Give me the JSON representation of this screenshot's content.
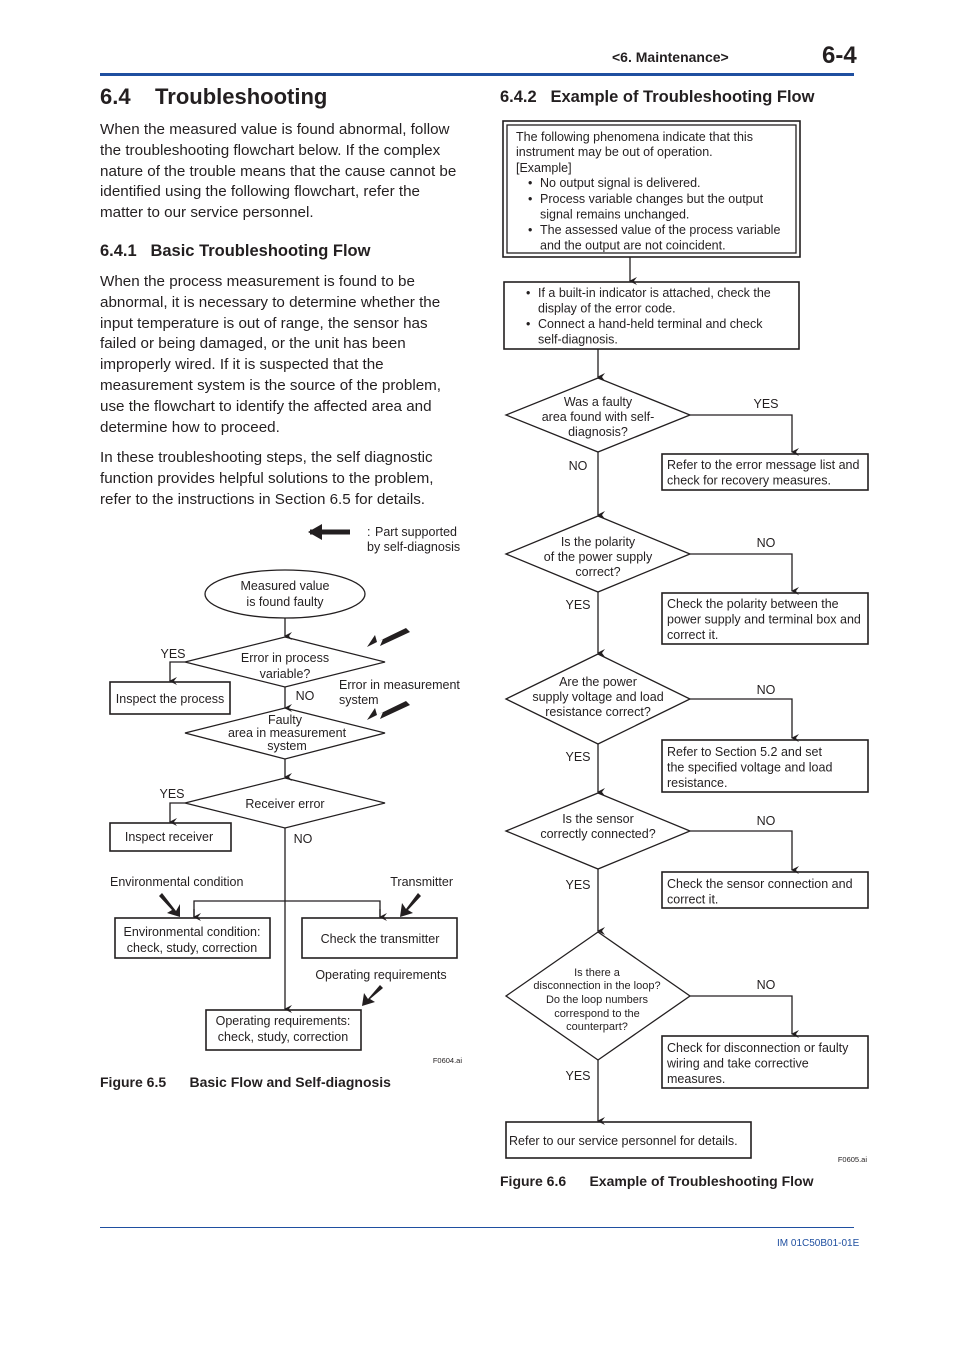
{
  "header": {
    "section": "<6.  Maintenance>",
    "page_number": "6-4"
  },
  "footer": {
    "doc_id": "IM 01C50B01-01E"
  },
  "left": {
    "section_title": "6.4    Troubleshooting",
    "intro": "When the measured value is found abnormal, follow the troubleshooting flowchart below. If the complex nature of the trouble means that the cause cannot be identified using the following flowchart, refer the matter to our service personnel.",
    "subsection_title": "6.4.1   Basic Troubleshooting Flow",
    "para1": "When the process measurement is found to be abnormal, it is necessary to determine whether the input temperature is out of range, the sensor has failed or being damaged, or the unit has been improperly wired. If it is suspected that the measurement system is the source of the problem, use the flowchart to identify the affected area and determine how to proceed.",
    "para2": "In these troubleshooting steps, the self diagnostic function provides helpful solutions to the problem, refer to the instructions in Section 6.5 for details.",
    "figure": {
      "legend_colon": ":",
      "legend_line1": "Part supported",
      "legend_line2": "by self-diagnosis",
      "start_line1": "Measured value",
      "start_line2": "is found faulty",
      "d1_line1": "Error in process",
      "d1_line2": "variable?",
      "yes1": "YES",
      "no1": "NO",
      "inspect_process": "Inspect the process",
      "err_meas_line1": "Error in measurement",
      "err_meas_line2": "system",
      "d2_line1": "Faulty",
      "d2_line2": "area in measurement",
      "d2_line3": "system",
      "d3": "Receiver error",
      "yes3": "YES",
      "no3": "NO",
      "inspect_receiver": "Inspect receiver",
      "env_label": "Environmental condition",
      "transmitter_label": "Transmitter",
      "env_box_line1": "Environmental condition:",
      "env_box_line2": "check, study, correction",
      "check_transmitter": "Check the transmitter",
      "op_label": "Operating requirements",
      "op_box_line1": "Operating requirements:",
      "op_box_line2": "check, study, correction",
      "file_id": "F0604.ai",
      "caption": "Figure 6.5      Basic Flow and Self-diagnosis"
    }
  },
  "right": {
    "subsection_title": "6.4.2   Example of Troubleshooting Flow",
    "figure": {
      "intro_line1": "The following phenomena indicate that this",
      "intro_line2": "instrument may be out of operation.",
      "intro_line3": "[Example]",
      "examples": [
        "No output signal is delivered.",
        "Process variable changes but the output signal remains unchanged.",
        "The assessed value of the process variable and the output are not coincident."
      ],
      "checks": [
        "If a built-in indicator is attached, check the display of the error code.",
        "Connect a hand-held terminal and check self-diagnosis."
      ],
      "q1": [
        "Was a faulty",
        "area found with self-",
        "diagnosis?"
      ],
      "q1_yes": "YES",
      "q1_no": "NO",
      "a1": "Refer to the error message list and check for recovery measures.",
      "q2": [
        "Is the polarity",
        "of the power supply",
        "correct?"
      ],
      "q2_no": "NO",
      "q2_yes": "YES",
      "a2": "Check the polarity between the power supply and terminal box and correct it.",
      "q3": [
        "Are the power",
        "supply voltage and load",
        "resistance correct?"
      ],
      "q3_no": "NO",
      "q3_yes": "YES",
      "a3": "Refer to Section 5.2 and set the specified voltage and load resistance.",
      "q4": [
        "Is the sensor",
        "correctly connected?"
      ],
      "q4_no": "NO",
      "q4_yes": "YES",
      "a4": "Check the sensor connection and correct it.",
      "q5": [
        "Is there a",
        "disconnection in the loop?",
        "Do the loop numbers",
        "correspond to the",
        "counterpart?"
      ],
      "q5_no": "NO",
      "q5_yes": "YES",
      "a5": "Check for disconnection or faulty wiring and take corrective measures.",
      "final": "Refer to our service personnel for details.",
      "file_id": "F0605.ai",
      "caption": "Figure 6.6      Example of Troubleshooting Flow"
    }
  }
}
